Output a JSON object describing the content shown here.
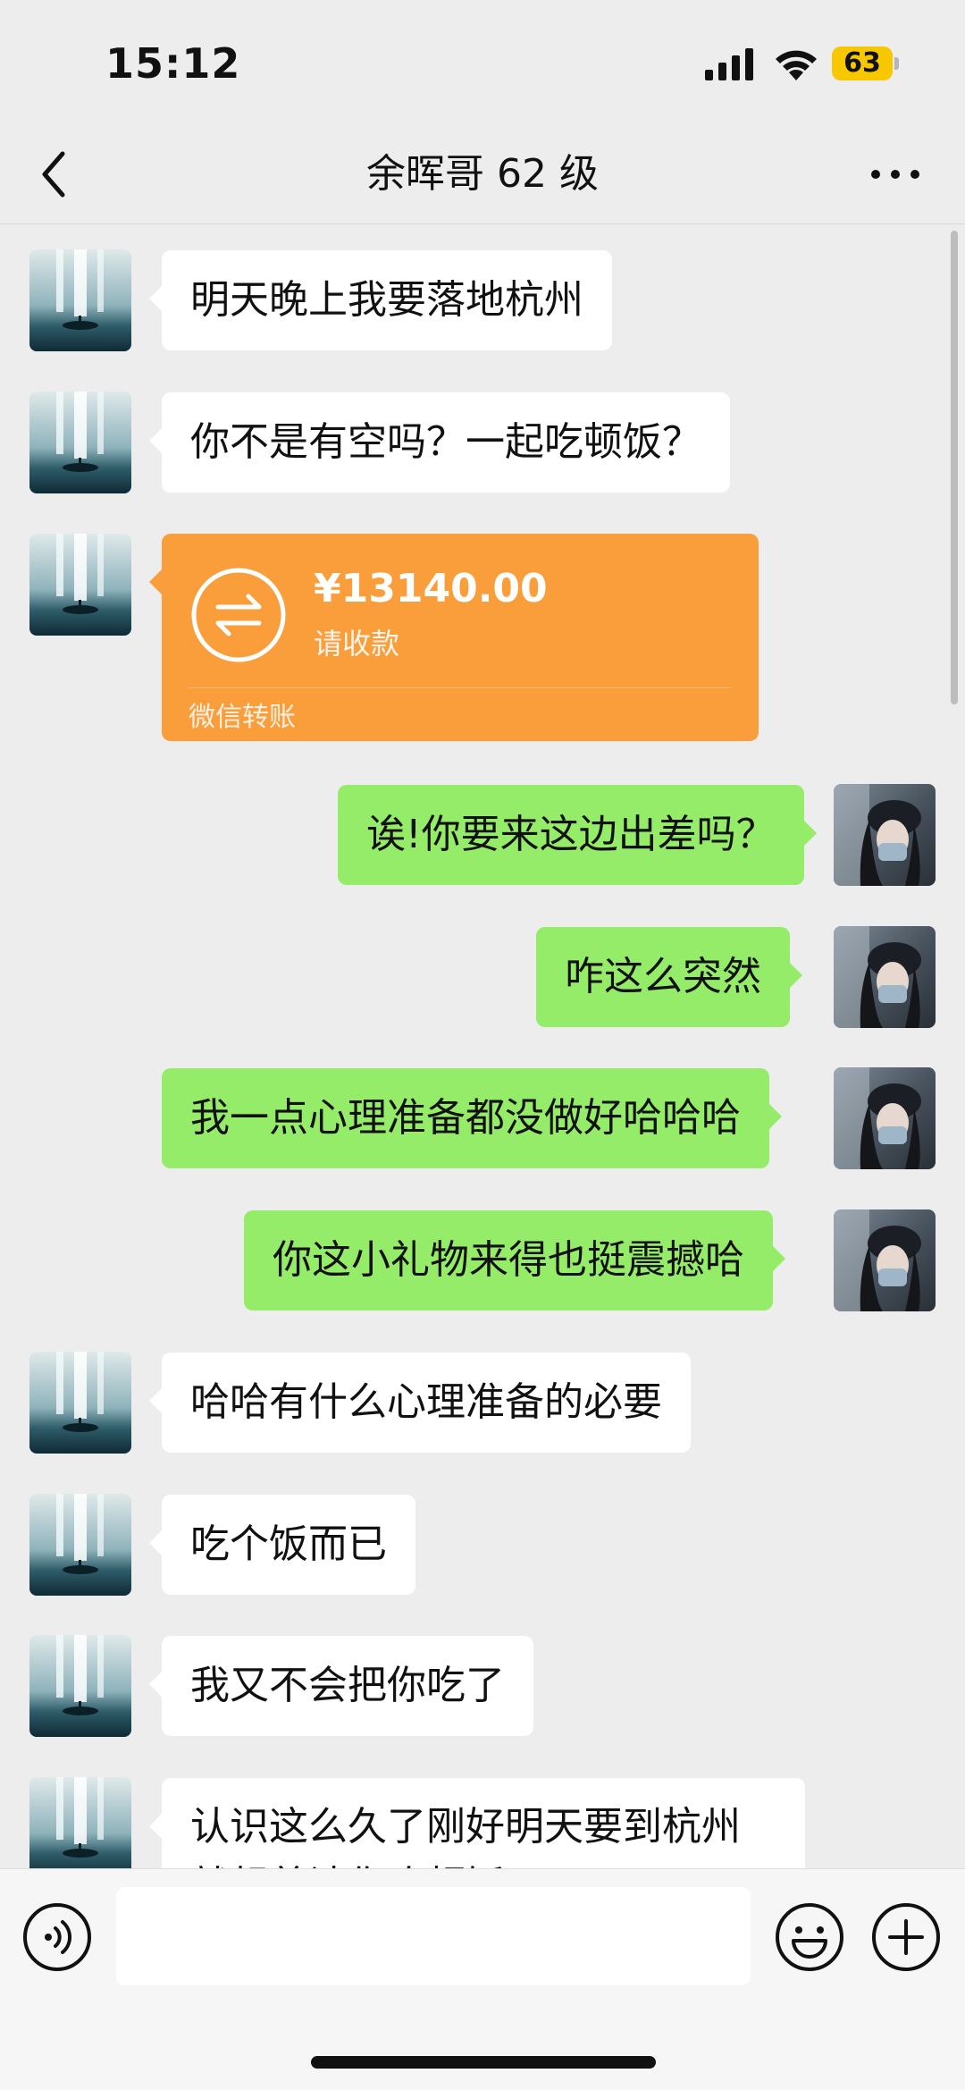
{
  "status": {
    "time": "15:12",
    "battery": "63"
  },
  "header": {
    "title": "余晖哥 62 级"
  },
  "messages": [
    {
      "side": "in",
      "text": "明天晚上我要落地杭州"
    },
    {
      "side": "in",
      "text": "你不是有空吗？一起吃顿饭？"
    },
    {
      "side": "out",
      "text": "诶!你要来这边出差吗？"
    },
    {
      "side": "out",
      "text": "咋这么突然"
    },
    {
      "side": "out",
      "text": "我一点心理准备都没做好哈哈哈"
    },
    {
      "side": "out",
      "text": "你这小礼物来得也挺震撼哈"
    },
    {
      "side": "in",
      "text": "哈哈有什么心理准备的必要"
    },
    {
      "side": "in",
      "text": "吃个饭而已"
    },
    {
      "side": "in",
      "text": "我又不会把你吃了"
    },
    {
      "side": "in",
      "text": "认识这么久了刚好明天要到杭州就想着请你吃顿饭"
    }
  ],
  "transfer": {
    "amount": "¥13140.00",
    "status": "请收款",
    "label": "微信转账"
  },
  "colors": {
    "incoming": "#ffffff",
    "outgoing": "#95ec69",
    "transfer": "#fa9d3b",
    "background": "#ededed",
    "battery": "#f7c800"
  },
  "icons": {
    "back": "chevron-left-icon",
    "more": "more-dots-icon",
    "voice": "voice-icon",
    "emoji": "emoji-icon",
    "plus": "plus-icon",
    "transfer": "transfer-arrows-icon"
  }
}
